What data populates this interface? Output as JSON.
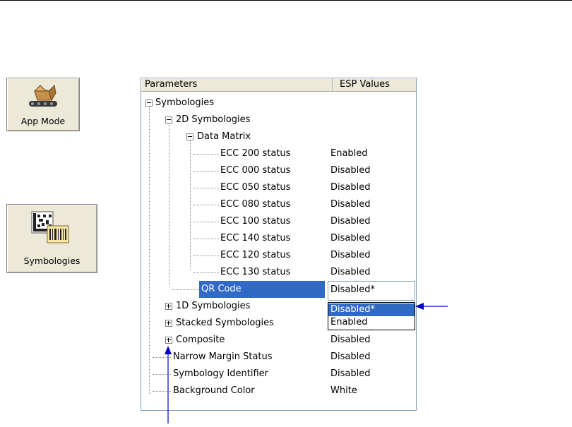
{
  "toolbar": {
    "app_mode": {
      "label": "App Mode",
      "icon": "box-on-conveyor-icon"
    },
    "symbologies": {
      "label": "Symbologies",
      "icon": "datamatrix-barcode-icon"
    }
  },
  "tree": {
    "header": {
      "parameters": "Parameters",
      "esp_values": "ESP Values"
    },
    "symbologies": "Symbologies",
    "two_d": "2D Symbologies",
    "data_matrix": "Data Matrix",
    "ecc_items": [
      {
        "label": "ECC 200 status",
        "value": "Enabled"
      },
      {
        "label": "ECC 000 status",
        "value": "Disabled"
      },
      {
        "label": "ECC 050 status",
        "value": "Disabled"
      },
      {
        "label": "ECC 080 status",
        "value": "Disabled"
      },
      {
        "label": "ECC 100 status",
        "value": "Disabled"
      },
      {
        "label": "ECC 140 status",
        "value": "Disabled"
      },
      {
        "label": "ECC 120 status",
        "value": "Disabled"
      },
      {
        "label": "ECC 130 status",
        "value": "Disabled"
      }
    ],
    "qr_code": {
      "label": "QR Code",
      "value": "Disabled*"
    },
    "dropdown_options": [
      "Disabled*",
      "Enabled"
    ],
    "one_d": "1D Symbologies",
    "stacked": "Stacked Symbologies",
    "composite": {
      "label": "Composite",
      "value": "Disabled"
    },
    "narrow_margin": {
      "label": "Narrow Margin Status",
      "value": "Disabled"
    },
    "symbology_identifier": {
      "label": "Symbology Identifier",
      "value": "Disabled"
    },
    "background_color": {
      "label": "Background Color",
      "value": "White"
    }
  },
  "colors": {
    "selection": "#316ac5",
    "arrow": "#0000cc",
    "button_face": "#ece9d8"
  }
}
